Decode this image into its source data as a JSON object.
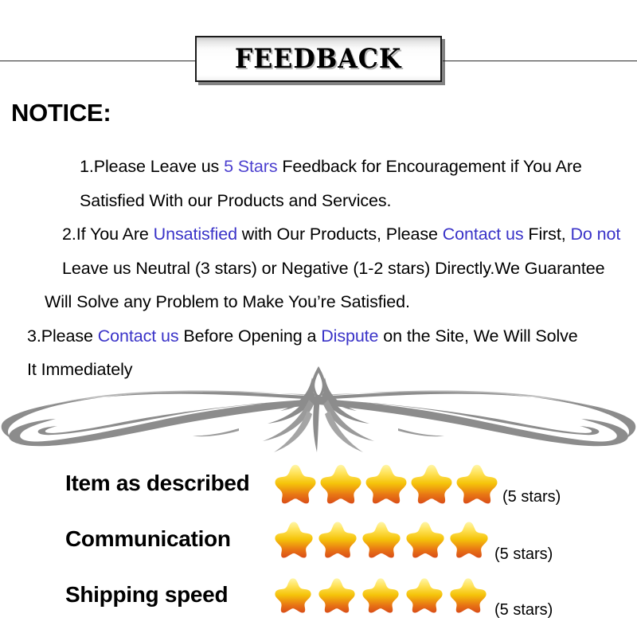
{
  "header": {
    "title": "FEEDBACK"
  },
  "notice": {
    "heading": "NOTICE",
    "heading_colon": ":",
    "lines": [
      {
        "segments": [
          {
            "text": "1.Please Leave us ",
            "style": "plain"
          },
          {
            "text": " 5 Stars ",
            "style": "violet"
          },
          {
            "text": " Feedback for  Encouragement  if You Are",
            "style": "plain"
          }
        ],
        "indent": false
      },
      {
        "segments": [
          {
            "text": "Satisfied With our Products and Services.",
            "style": "plain"
          }
        ],
        "indent": true
      },
      {
        "segments": [
          {
            "text": "2.If You Are ",
            "style": "plain"
          },
          {
            "text": "Unsatisfied",
            "style": "blue"
          },
          {
            "text": " with Our Products, Please ",
            "style": "plain"
          },
          {
            "text": "Contact us",
            "style": "blue"
          },
          {
            "text": " First, ",
            "style": "plain"
          },
          {
            "text": "Do not",
            "style": "blue"
          }
        ],
        "indent": false
      },
      {
        "segments": [
          {
            "text": "Leave us Neutral (3 stars) or Negative (1-2 stars) Directly.We Guarantee",
            "style": "plain"
          }
        ],
        "indent": true
      },
      {
        "segments": [
          {
            "text": "Will Solve any Problem to Make You’re  Satisfied.",
            "style": "plain"
          }
        ],
        "indent": true
      },
      {
        "segments": [
          {
            "text": "3.Please ",
            "style": "plain"
          },
          {
            "text": "Contact us",
            "style": "blue"
          },
          {
            "text": " Before Opening a ",
            "style": "plain"
          },
          {
            "text": "Dispute",
            "style": "blue"
          },
          {
            "text": " on the Site, We Will Solve",
            "style": "plain"
          }
        ],
        "indent": false
      },
      {
        "segments": [
          {
            "text": "It Immediately",
            "style": "plain"
          }
        ],
        "indent": true
      }
    ]
  },
  "divider": {
    "icon": "filigree-ornament",
    "color": "#8c8c8c"
  },
  "ratings": [
    {
      "label": "Item as described",
      "stars": 5,
      "caption": "(5 stars)"
    },
    {
      "label": "Communication",
      "stars": 5,
      "caption": "(5 stars)"
    },
    {
      "label": "Shipping speed",
      "stars": 5,
      "caption": "(5 stars)"
    }
  ],
  "colors": {
    "highlight_blue": "#3a33c8",
    "highlight_violet": "#4b3fcf",
    "star_top": "#fff6a8",
    "star_mid": "#f5c40a",
    "star_bottom": "#e87414",
    "star_edge": "#d94d18",
    "ornament_gray": "#8c8c8c",
    "text_black": "#000000"
  }
}
